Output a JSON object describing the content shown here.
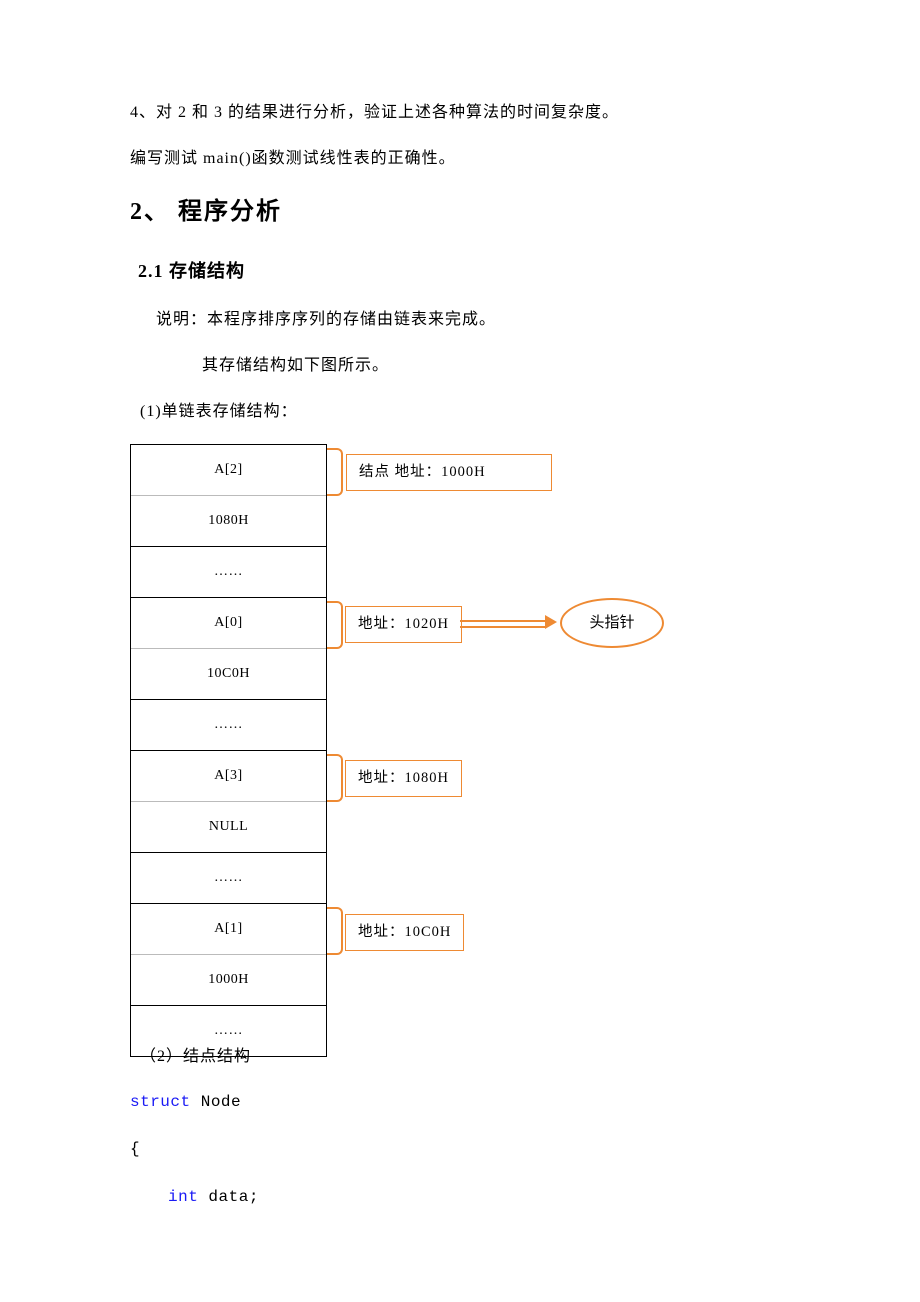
{
  "para1": "4、对 2 和 3 的结果进行分析，验证上述各种算法的时间复杂度。",
  "para2": "编写测试 main()函数测试线性表的正确性。",
  "h2": "2、 程序分析",
  "h3": "2.1 存储结构",
  "desc1": "说明：本程序排序序列的存储由链表来完成。",
  "desc2": "其存储结构如下图所示。",
  "desc3": "(1)单链表存储结构：",
  "diagram": {
    "cells": [
      "A[2]",
      "1080H",
      "……",
      "A[0]",
      "10C0H",
      "……",
      "A[3]",
      "NULL",
      "……",
      "A[1]",
      "1000H",
      "……"
    ],
    "callouts": {
      "c1": "结点  地址：1000H",
      "c2": "地址：1020H",
      "c3": "地址：1080H",
      "c4": "地址：10C0H"
    },
    "head_pointer": "头指针"
  },
  "section2_title": "（2）结点结构",
  "code": {
    "kw_struct": "struct",
    "name": " Node",
    "brace_open": "{",
    "indent_kw_int": "int",
    "indent_rest": " data;"
  }
}
